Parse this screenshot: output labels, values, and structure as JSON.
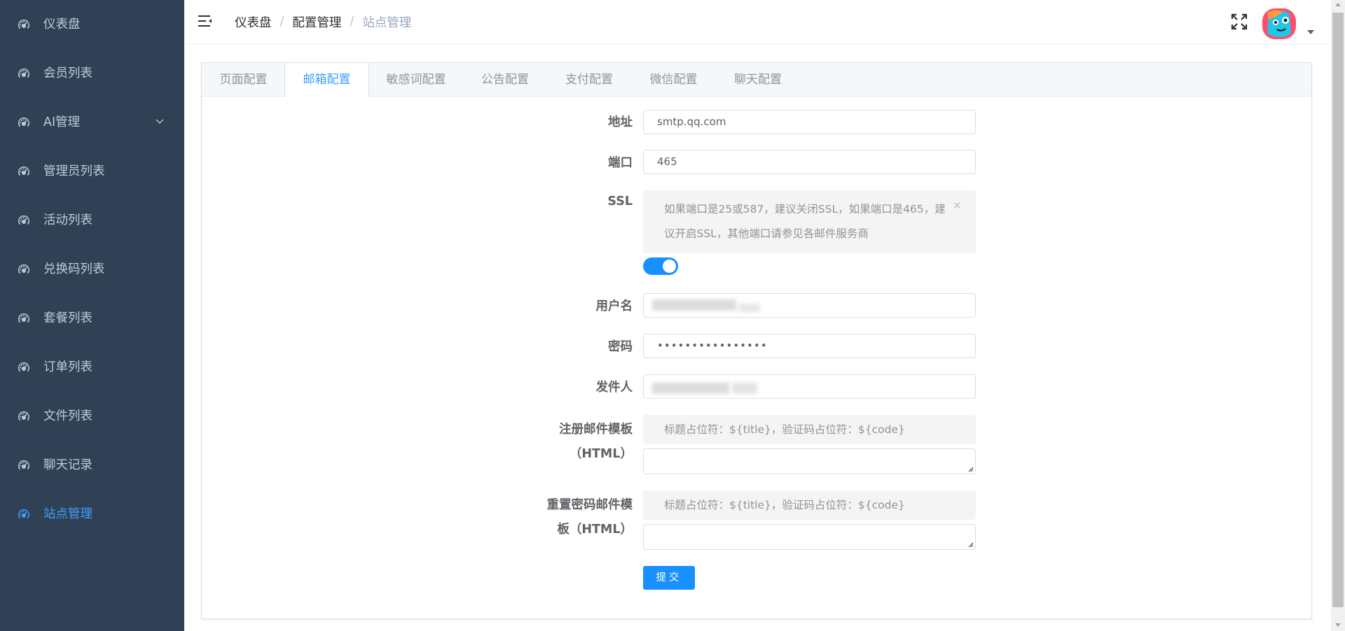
{
  "sidebar": {
    "items": [
      {
        "label": "仪表盘",
        "icon": "dashboard-icon"
      },
      {
        "label": "会员列表",
        "icon": "dashboard-icon"
      },
      {
        "label": "AI管理",
        "icon": "dashboard-icon",
        "has_submenu": true
      },
      {
        "label": "管理员列表",
        "icon": "dashboard-icon"
      },
      {
        "label": "活动列表",
        "icon": "dashboard-icon"
      },
      {
        "label": "兑换码列表",
        "icon": "dashboard-icon"
      },
      {
        "label": "套餐列表",
        "icon": "dashboard-icon"
      },
      {
        "label": "订单列表",
        "icon": "dashboard-icon"
      },
      {
        "label": "文件列表",
        "icon": "dashboard-icon"
      },
      {
        "label": "聊天记录",
        "icon": "dashboard-icon"
      },
      {
        "label": "站点管理",
        "icon": "dashboard-icon",
        "active": true
      }
    ]
  },
  "header": {
    "breadcrumb": [
      "仪表盘",
      "配置管理",
      "站点管理"
    ],
    "separator": "/"
  },
  "tabs": [
    "页面配置",
    "邮箱配置",
    "敏感词配置",
    "公告配置",
    "支付配置",
    "微信配置",
    "聊天配置"
  ],
  "active_tab": "邮箱配置",
  "form": {
    "address_label": "地址",
    "address_value": "smtp.qq.com",
    "port_label": "端口",
    "port_value": "465",
    "ssl_label": "SSL",
    "ssl_alert_line1": "如果端口是25或587，建议关闭SSL，如果端口是465，建",
    "ssl_alert_line2": "议开启SSL，其他端口请参见各邮件服务商",
    "ssl_enabled": true,
    "username_label": "用户名",
    "password_label": "密码",
    "password_value": "••••••••••••••••",
    "sender_label": "发件人",
    "register_template_label_1": "注册邮件模板",
    "register_template_label_2": "（HTML）",
    "register_template_hint": "标题占位符：${title}，验证码占位符：${code}",
    "reset_template_label_1": "重置密码邮件模",
    "reset_template_label_2": "板（HTML）",
    "reset_template_hint": "标题占位符：${title}，验证码占位符：${code}",
    "submit_label": "提交"
  },
  "colors": {
    "sidebar_bg": "#304156",
    "sidebar_text": "#bfcbd9",
    "accent": "#409eff",
    "switch_on": "#1890ff",
    "submit": "#1890ff"
  }
}
